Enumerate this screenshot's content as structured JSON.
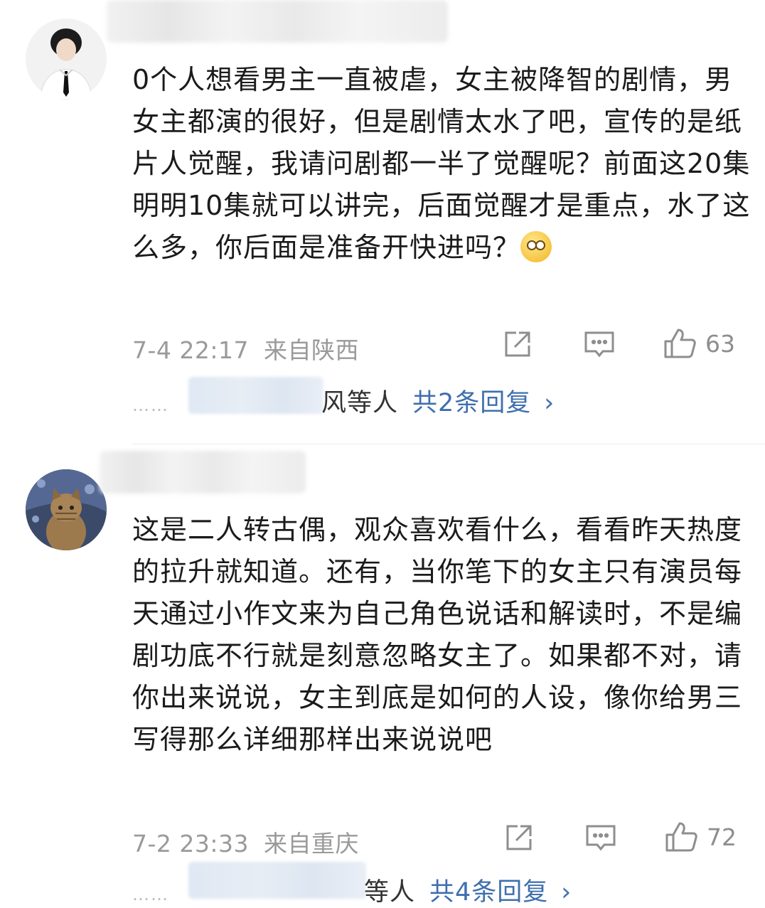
{
  "comments": [
    {
      "text_before_emoji": "0个人想看男主一直被虐，女主被降智的剧情，男女主都演的很好，但是剧情太水了吧，宣传的是纸片人觉醒，我请问剧都一半了觉醒呢？前面这20集明明10集就可以讲完，后面觉醒才是重点，水了这么多，你后面是准备开快进吗？",
      "emoji": "rolling-eyes-emoji",
      "time": "7-4 22:17",
      "location": "来自陕西",
      "likes": "63",
      "reply_users_tail": "风等人",
      "reply_link": "共2条回复"
    },
    {
      "text_before_emoji": "这是二人转古偶，观众喜欢看什么，看看昨天热度的拉升就知道。还有，当你笔下的女主只有演员每天通过小作文来为自己角色说话和解读时，不是编剧功底不行就是刻意忽略女主了。如果都不对，请你出来说说，女主到底是如何的人设，像你给男三写得那么详细那样出来说说吧",
      "time": "7-2 23:33",
      "location": "来自重庆",
      "likes": "72",
      "reply_users_tail": "等人",
      "reply_link": "共4条回复"
    }
  ],
  "icons": {
    "share": "share-icon",
    "comment": "comment-icon",
    "like": "thumb-up-icon",
    "chevron": "chevron-right-icon"
  },
  "colors": {
    "link": "#3f6fad",
    "meta": "#9a9a9a"
  }
}
